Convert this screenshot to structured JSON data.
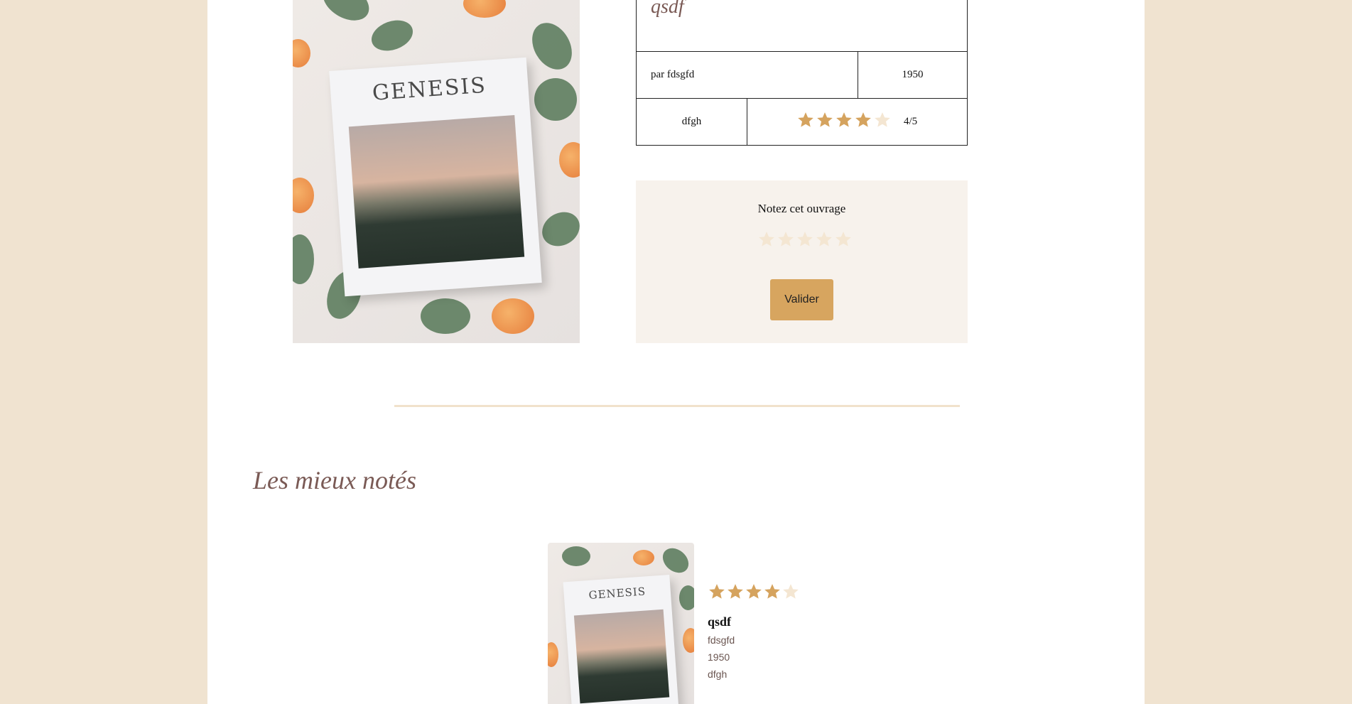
{
  "book": {
    "title": "qsdf",
    "author_line": "par fdsgfd",
    "year": "1950",
    "genre": "dfgh",
    "rating": 4,
    "rating_max": 5,
    "rating_text": "4/5",
    "cover_text": "GENESIS"
  },
  "rate_box": {
    "label": "Notez cet ouvrage",
    "selected": 0,
    "submit_label": "Valider"
  },
  "top_rated": {
    "heading": "Les mieux notés",
    "items": [
      {
        "title": "qsdf",
        "author": "fdsgfd",
        "year": "1950",
        "genre": "dfgh",
        "rating": 4,
        "cover_text": "GENESIS"
      }
    ]
  },
  "colors": {
    "star_filled": "#d5a35e",
    "star_empty": "#f4e6d2",
    "accent": "#d7a55f",
    "title": "#7a5a55"
  },
  "icons": {
    "star": "star-icon"
  }
}
